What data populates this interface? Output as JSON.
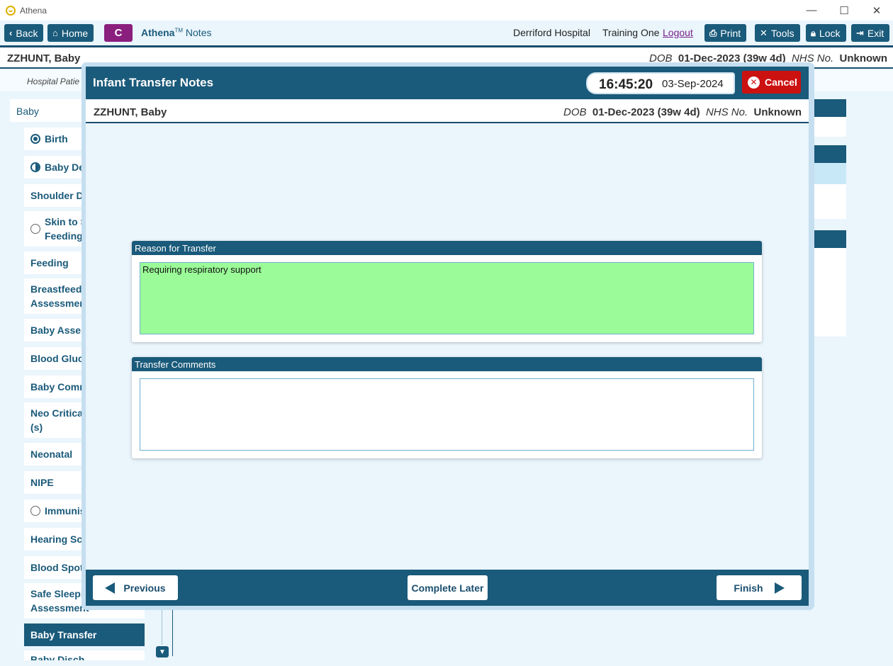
{
  "window": {
    "title": "Athena",
    "minimize": "—",
    "maximize": "☐",
    "close": "✕"
  },
  "toolbar": {
    "back": "Back",
    "home": "Home",
    "c_badge": "C",
    "app_name": "Athena",
    "app_tm": "TM",
    "app_suffix": "Notes",
    "hospital": "Derriford Hospital",
    "user": "Training One",
    "logout": "Logout",
    "print": "Print",
    "tools": "Tools",
    "lock": "Lock",
    "exit": "Exit"
  },
  "patient": {
    "name": "ZZHUNT, Baby",
    "dob_label": "DOB",
    "dob": "01-Dec-2023 (39w 4d)",
    "nhs_label": "NHS No.",
    "nhs": "Unknown",
    "sub_label": "Hospital Patie"
  },
  "sidebar": {
    "header": "Baby",
    "items": [
      {
        "label": "Birth"
      },
      {
        "label": "Baby Dev"
      },
      {
        "label": "Shoulder D"
      },
      {
        "label": "Skin to S",
        "line2": "Feeding"
      },
      {
        "label": "Feeding"
      },
      {
        "label": "Breastfeedi",
        "line2": "Assessmen"
      },
      {
        "label": "Baby Asses"
      },
      {
        "label": "Blood Gluc"
      },
      {
        "label": "Baby Comm"
      },
      {
        "label": "Neo Critica",
        "line2": "(s)"
      },
      {
        "label": "Neonatal"
      },
      {
        "label": "NIPE"
      },
      {
        "label": "Immunis"
      },
      {
        "label": "Hearing Sc"
      },
      {
        "label": "Blood Spot"
      },
      {
        "label": "Safe Sleepi",
        "line2": "Assessment"
      },
      {
        "label": "Baby Transfer"
      },
      {
        "label": "Baby Disch"
      }
    ]
  },
  "modal": {
    "title": "Infant Transfer Notes",
    "time": "16:45:20",
    "date": "03-Sep-2024",
    "cancel": "Cancel",
    "reason_header": "Reason for Transfer",
    "reason_value": "Requiring respiratory support",
    "comments_header": "Transfer Comments",
    "comments_value": "",
    "previous": "Previous",
    "complete_later": "Complete Later",
    "finish": "Finish"
  },
  "colors": {
    "primary": "#1a5a7a",
    "accent_c": "#8a1f7e",
    "cancel": "#cc1111",
    "valid_field": "#9bfb98"
  }
}
